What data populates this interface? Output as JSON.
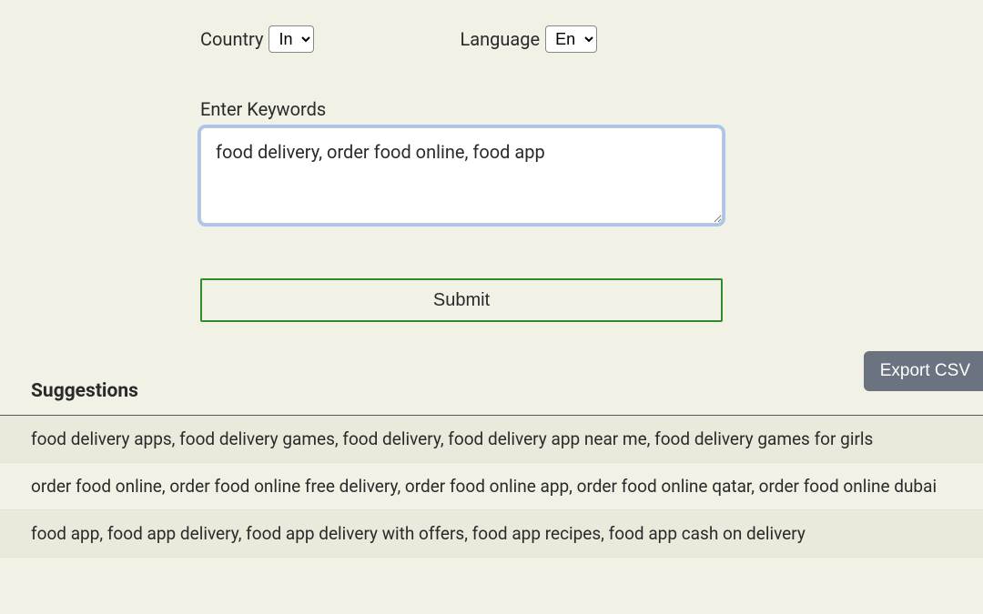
{
  "form": {
    "country_label": "Country",
    "country_value": "In",
    "language_label": "Language",
    "language_value": "En",
    "keywords_label": "Enter Keywords",
    "keywords_value": "food delivery, order food online, food app",
    "submit_label": "Submit"
  },
  "export_label": "Export CSV",
  "suggestions": {
    "heading": "Suggestions",
    "rows": [
      "food delivery apps, food delivery games, food delivery, food delivery app near me, food delivery games for girls",
      "order food online, order food online free delivery, order food online app, order food online qatar, order food online dubai",
      "food app, food app delivery, food app delivery with offers, food app recipes, food app cash on delivery"
    ]
  }
}
